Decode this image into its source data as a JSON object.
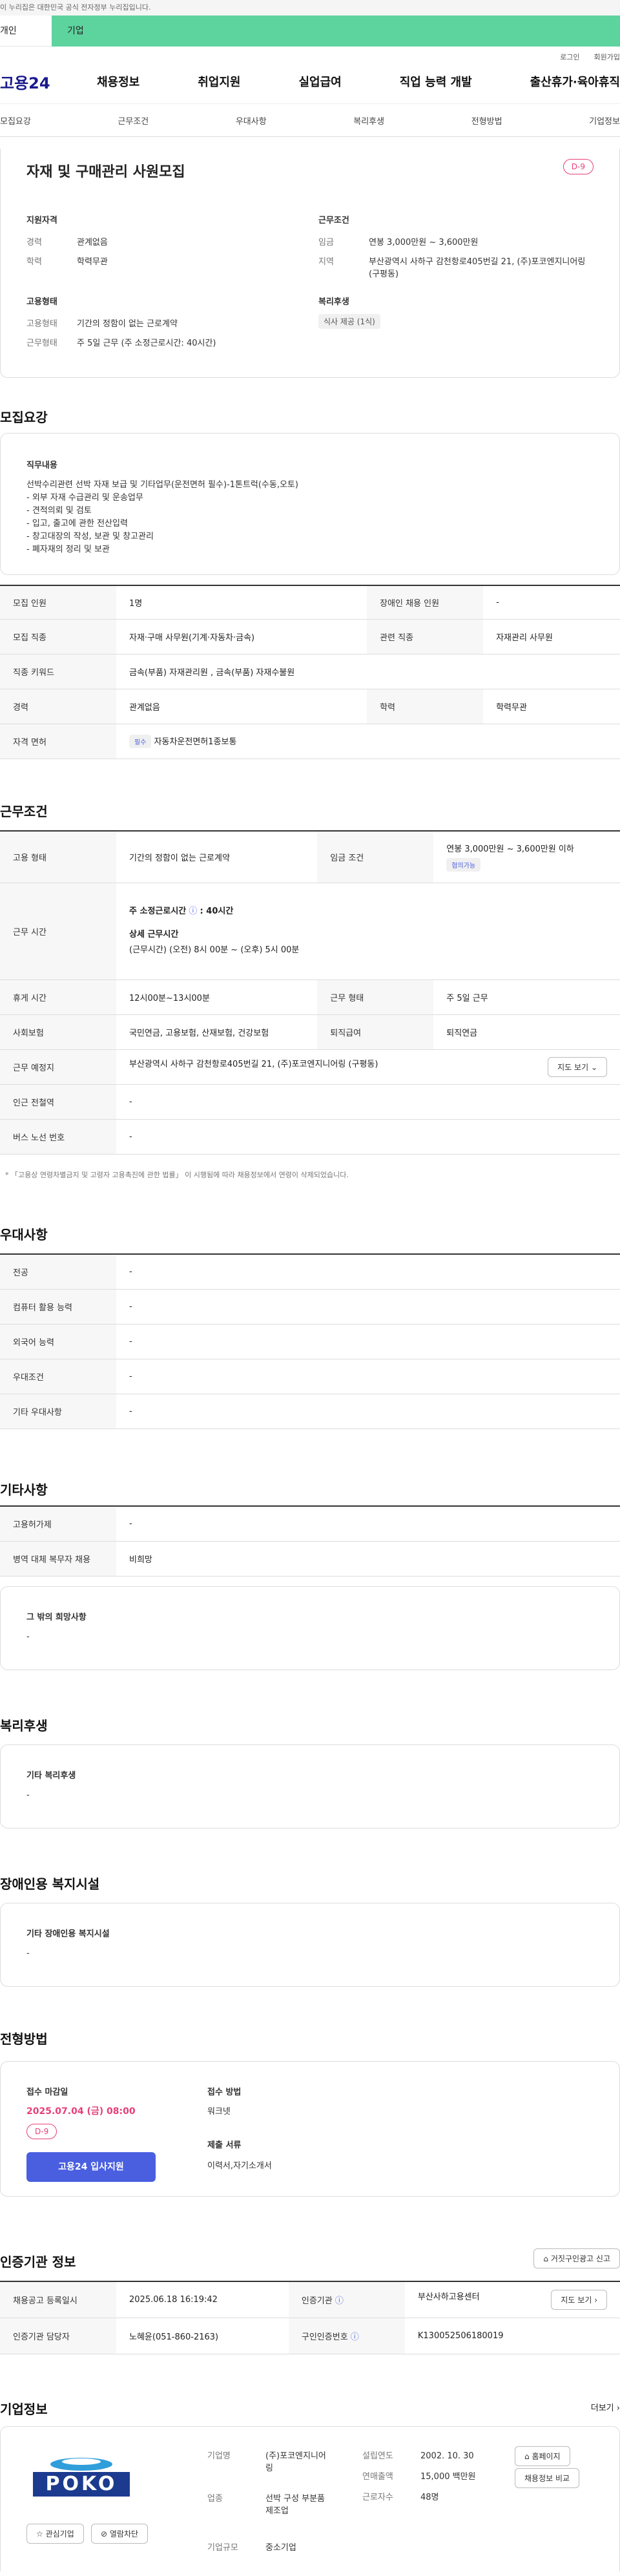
{
  "banner": "이 누리집은 대한민국 공식 전자정부 누리집입니다.",
  "tabs": {
    "personal": "개인",
    "company": "기업"
  },
  "top_links": {
    "login": "로그인",
    "signup": "회원가입"
  },
  "gnb": {
    "logo": "고용24",
    "menu": [
      "채용정보",
      "취업지원",
      "실업급여",
      "직업 능력 개발",
      "출산휴가·육아휴직"
    ]
  },
  "snb": [
    "모집요강",
    "근무조건",
    "우대사항",
    "복리후생",
    "전형방법",
    "기업정보"
  ],
  "summary": {
    "title": "자재 및 구매관리 사원모집",
    "dday": "D-9",
    "qual_label": "지원자격",
    "career_k": "경력",
    "career_v": "관계없음",
    "edu_k": "학력",
    "edu_v": "학력무관",
    "emp_label": "고용형태",
    "emptype_k": "고용형태",
    "emptype_v": "기간의 정함이 없는 근로계약",
    "worktype_k": "근무형태",
    "worktype_v": "주 5일 근무 (주 소정근로시간: 40시간)",
    "cond_label": "근무조건",
    "wage_k": "임금",
    "wage_v": "연봉 3,000만원 ~ 3,600만원",
    "area_k": "지역",
    "area_v": "부산광역시 사하구 감천항로405번길 21, (주)포코엔지니어링 (구평동)",
    "welfare_label": "복리후생",
    "welfare_v": "식사 제공 (1식)"
  },
  "recruit": {
    "section": "모집요강",
    "duty_label": "직무내용",
    "duty_lines": [
      "선박수리관련 선박 자재 보급 및 기타업무(운전면허 필수)-1톤트럭(수동,오토)",
      "- 외부 자재 수급관리 및 운송업무",
      "- 견적의뢰 및 검토",
      "- 입고, 출고에 관한 전산입력",
      "- 창고대장의 작성, 보관 및 창고관리",
      "- 폐자재의 정리 및 보관"
    ],
    "count_k": "모집 인원",
    "count_v": "1명",
    "disabled_k": "장애인 채용 인원",
    "disabled_v": "-",
    "job_k": "모집 직종",
    "job_v": "자재·구매 사무원(기계·자동차·금속)",
    "rel_k": "관련 직종",
    "rel_v": "자재관리 사무원",
    "kw_k": "직종 키워드",
    "kw_v": "금속(부품) 자재관리원 , 금속(부품) 자재수불원",
    "career_k": "경력",
    "career_v": "관계없음",
    "edu_k": "학력",
    "edu_v": "학력무관",
    "lic_k": "자격 면허",
    "lic_badge": "필수",
    "lic_v": "자동차운전면허1종보통"
  },
  "work": {
    "section": "근무조건",
    "emp_k": "고용 형태",
    "emp_v": "기간의 정함이 없는 근로계약",
    "wage_k": "임금 조건",
    "wage_v": "연봉 3,000만원 ~ 3,600만원 이하",
    "wage_tag": "협의가능",
    "time_k": "근무 시간",
    "time_h1": "주 소정근로시간",
    "time_v1": ": 40시간",
    "time_h2": "상세 근무시간",
    "time_v2": "(근무시간) (오전) 8시 00분 ~ (오후) 5시 00분",
    "break_k": "휴게 시간",
    "break_v": "12시00분~13시00분",
    "form_k": "근무 형태",
    "form_v": "주 5일 근무",
    "ins_k": "사회보험",
    "ins_v": "국민연금, 고용보험, 산재보험, 건강보험",
    "ret_k": "퇴직급여",
    "ret_v": "퇴직연금",
    "place_k": "근무 예정지",
    "place_v": "부산광역시 사하구 감천항로405번길 21, (주)포코엔지니어링 (구평동)",
    "map_btn": "지도 보기",
    "subway_k": "인근 전철역",
    "subway_v": "-",
    "bus_k": "버스 노선 번호",
    "bus_v": "-",
    "note": "* 「고용상 연령차별금지 및 고령자 고용촉진에 관한 법률」 이 시행됨에 따라 채용정보에서 연령이 삭제되었습니다."
  },
  "pref": {
    "section": "우대사항",
    "rows": [
      [
        "전공",
        "-"
      ],
      [
        "컴퓨터 활용 능력",
        "-"
      ],
      [
        "외국어 능력",
        "-"
      ],
      [
        "우대조건",
        "-"
      ],
      [
        "기타 우대사항",
        "-"
      ]
    ]
  },
  "etc": {
    "section": "기타사항",
    "rows": [
      [
        "고용허가제",
        "-"
      ],
      [
        "병역 대체 복무자 채용",
        "비희망"
      ]
    ],
    "other_label": "그 밖의 희망사항",
    "other_v": "-"
  },
  "welfare": {
    "section": "복리후생",
    "label": "기타 복리후생",
    "v": "-"
  },
  "disab": {
    "section": "장애인용 복지시설",
    "label": "기타 장애인용 복지시설",
    "v": "-"
  },
  "select": {
    "section": "전형방법",
    "deadline_label": "접수 마감일",
    "deadline_v": "2025.07.04 (금) 08:00",
    "dday": "D-9",
    "apply_btn": "고용24 입사지원",
    "method_label": "접수 방법",
    "method_v": "워크넷",
    "docs_label": "제출 서류",
    "docs_v": "이력서,자기소개서"
  },
  "agency": {
    "section": "인증기관 정보",
    "report_btn": "거짓구인광고 신고",
    "reg_k": "채용공고 등록일시",
    "reg_v": "2025.06.18 16:19:42",
    "org_k": "인증기관",
    "org_v": "부산사하고용센터",
    "map_btn": "지도 보기",
    "mgr_k": "인증기관 담당자",
    "mgr_v": "노혜윤(051-860-2163)",
    "num_k": "구인인증번호",
    "num_v": "K130052506180019"
  },
  "company": {
    "section": "기업정보",
    "more": "더보기",
    "logo_text": "POKO",
    "fav_btn": "관심기업",
    "block_btn": "열람차단",
    "name_k": "기업명",
    "name_v": "(주)포코엔지니어링",
    "est_k": "설립연도",
    "est_v": "2002. 10. 30",
    "ind_k": "업종",
    "ind_v": "선박 구성 부분품 제조업",
    "sales_k": "연매출액",
    "sales_v": "15,000 백만원",
    "emp_k": "근로자수",
    "emp_v": "48명",
    "size_k": "기업규모",
    "size_v": "중소기업",
    "home_btn": "홈페이지",
    "jobs_btn": "채용정보 비교"
  },
  "colors": {
    "accent": "#4a5fe0",
    "green": "#5dd39e",
    "dday": "#e8407a"
  }
}
